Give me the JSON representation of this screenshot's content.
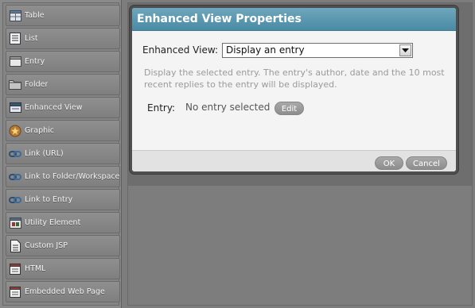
{
  "palette": {
    "items": [
      {
        "label": "Table",
        "icon": "table-icon"
      },
      {
        "label": "List",
        "icon": "list-icon"
      },
      {
        "label": "Entry",
        "icon": "entry-icon"
      },
      {
        "label": "Folder",
        "icon": "folder-icon"
      },
      {
        "label": "Enhanced View",
        "icon": "enhanced-view-icon"
      },
      {
        "label": "Graphic",
        "icon": "graphic-icon"
      },
      {
        "label": "Link (URL)",
        "icon": "link-icon"
      },
      {
        "label": "Link to Folder/Workspace",
        "icon": "link-icon"
      },
      {
        "label": "Link to Entry",
        "icon": "link-icon"
      },
      {
        "label": "Utility Element",
        "icon": "utility-icon"
      },
      {
        "label": "Custom JSP",
        "icon": "jsp-icon"
      },
      {
        "label": "HTML",
        "icon": "html-icon"
      },
      {
        "label": "Embedded Web Page",
        "icon": "web-page-icon"
      }
    ]
  },
  "dialog": {
    "title": "Enhanced View Properties",
    "enhanced_view_label": "Enhanced View:",
    "enhanced_view_value": "Display an entry",
    "help_text": "Display the selected entry. The entry's author, date and the 10 most recent replies to the entry will be displayed.",
    "entry_label": "Entry:",
    "entry_value": "No entry selected",
    "edit_label": "Edit",
    "ok_label": "OK",
    "cancel_label": "Cancel"
  },
  "colors": {
    "title_bar": "#5b98b1",
    "button": "#9b9b9b",
    "help_text": "#9a9a9a"
  }
}
